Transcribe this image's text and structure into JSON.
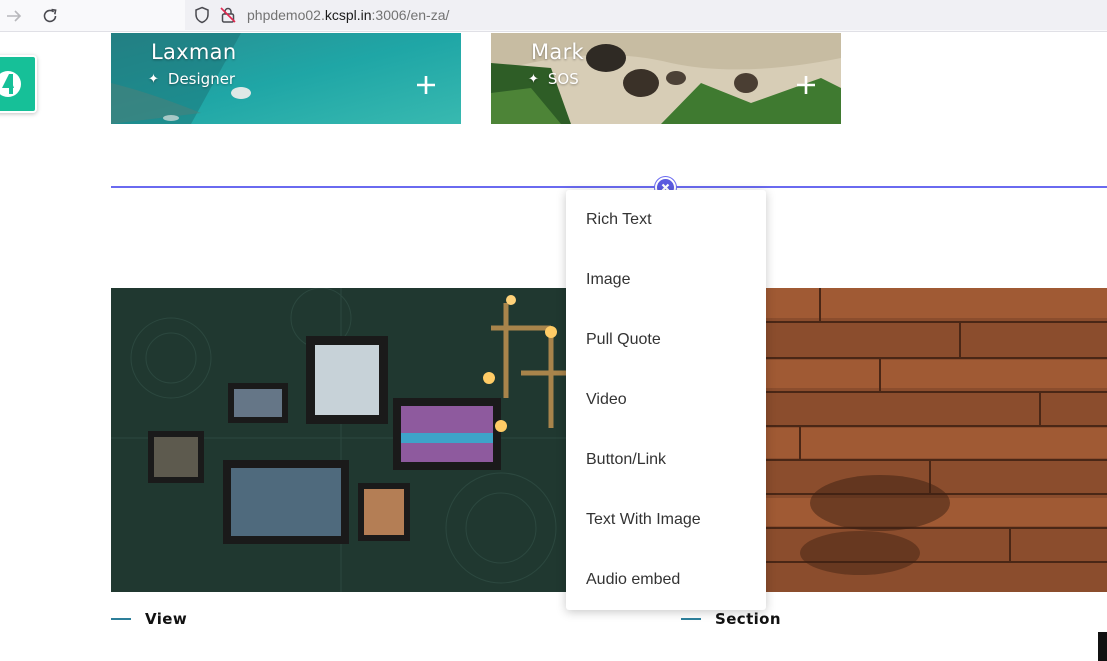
{
  "browser": {
    "url_prefix": "phpdemo02.",
    "url_domain": "kcspl.in",
    "url_suffix": ":3006/en-za/"
  },
  "cards": [
    {
      "name": "Laxman",
      "role": "Designer"
    },
    {
      "name": "Mark",
      "role": "SOS"
    }
  ],
  "block_menu": {
    "items": [
      "Rich Text",
      "Image",
      "Pull Quote",
      "Video",
      "Button/Link",
      "Text With Image",
      "Audio embed"
    ]
  },
  "captions": [
    "View",
    "Section"
  ],
  "colors": {
    "accent_line": "#6a6af0",
    "badge": "#16c098",
    "caption_dash": "#2d7f9a"
  }
}
